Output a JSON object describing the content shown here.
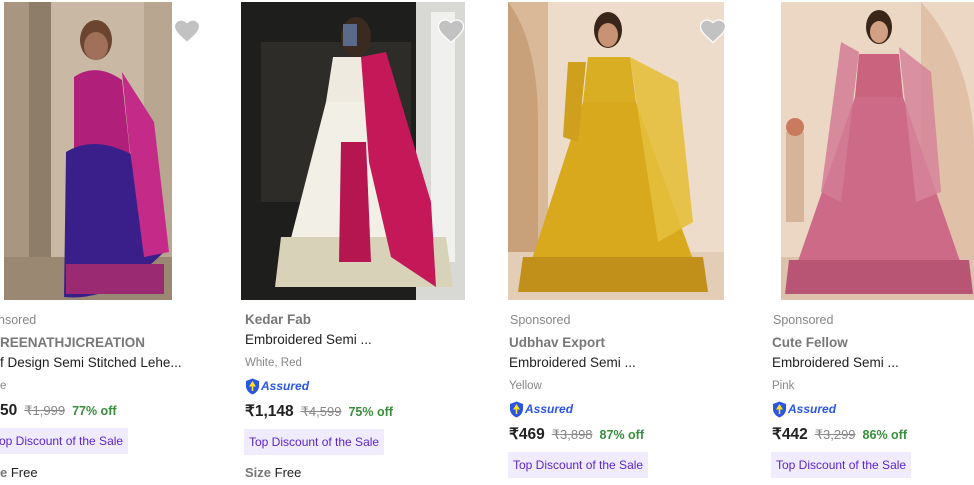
{
  "products": [
    {
      "sponsored": "nsored",
      "brand": "REENATHJICREATION",
      "title": "f Design Semi Stitched Lehe...",
      "variant": "e",
      "price": "50",
      "mrp": "₹1,999",
      "discount": "77% off",
      "badge": "op Discount of the Sale",
      "size_label": "e",
      "size_value": "Free"
    },
    {
      "brand": "Kedar Fab",
      "title": "Embroidered Semi ...",
      "variant": "White, Red",
      "assured": "Assured",
      "price": "₹1,148",
      "mrp": "₹4,599",
      "discount": "75% off",
      "badge": "Top Discount of the Sale",
      "size_label": "Size",
      "size_value": "Free"
    },
    {
      "sponsored": "Sponsored",
      "brand": "Udbhav Export",
      "title": "Embroidered Semi ...",
      "variant": "Yellow",
      "assured": "Assured",
      "price": "₹469",
      "mrp": "₹3,898",
      "discount": "87% off",
      "badge": "Top Discount of the Sale"
    },
    {
      "sponsored": "Sponsored",
      "brand": "Cute Fellow",
      "title": "Embroidered Semi ...",
      "variant": "Pink",
      "assured": "Assured",
      "price": "₹442",
      "mrp": "₹3,299",
      "discount": "86% off",
      "badge": "Top Discount of the Sale"
    }
  ],
  "colors": {
    "discount_green": "#388e3c",
    "badge_bg": "#f1ecfd",
    "badge_text": "#5b24c9",
    "assured_blue": "#2a55e5"
  },
  "icons": [
    "heart-icon",
    "assured-shield-icon"
  ]
}
